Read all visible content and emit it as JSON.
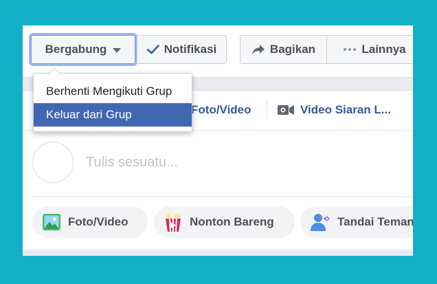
{
  "header": {
    "join_label": "Bergabung",
    "notify_label": "Notifikasi",
    "share_label": "Bagikan",
    "more_label": "Lainnya"
  },
  "dropdown": {
    "items": [
      {
        "label": "Berhenti Mengikuti Grup",
        "selected": false
      },
      {
        "label": "Keluar dari Grup",
        "selected": true
      }
    ]
  },
  "composer": {
    "tabs": [
      {
        "label": "Foto/Video",
        "icon": "photo-icon"
      },
      {
        "label": "Video Siaran L...",
        "icon": "video-camera-icon"
      }
    ],
    "placeholder": "Tulis sesuatu...",
    "actions": [
      {
        "label": "Foto/Video",
        "icon": "photo-icon"
      },
      {
        "label": "Nonton Bareng",
        "icon": "popcorn-icon"
      },
      {
        "label": "Tandai Teman",
        "icon": "tag-friend-icon"
      }
    ]
  },
  "colors": {
    "background": "#12b0c8",
    "accent": "#4267b2",
    "link": "#365899",
    "selected_item": "#4267b2"
  }
}
